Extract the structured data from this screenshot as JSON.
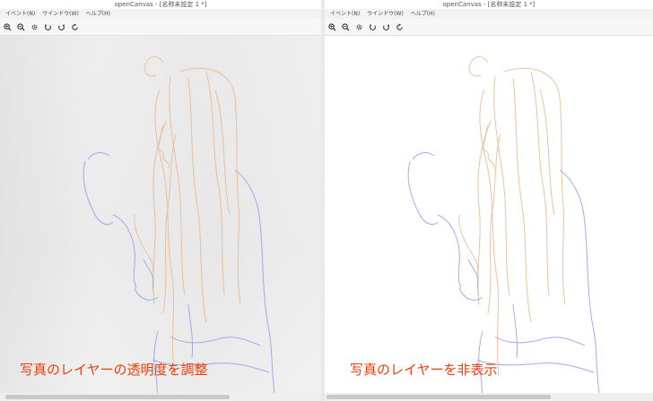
{
  "left_window": {
    "title": "openCanvas - [名称未設定 1 *]",
    "menu": [
      "イベント(N)",
      "ウインドウ(W)",
      "ヘルプ(H)"
    ],
    "tools": [
      "zoom-in-icon",
      "zoom-out-icon",
      "gear-icon",
      "rotate-left-icon",
      "rotate-right-icon",
      "refresh-icon"
    ],
    "caption": "写真のレイヤーの透明度を調整"
  },
  "right_window": {
    "title": "openCanvas - [名称未設定 1 *]",
    "menu": [
      "イベント(N)",
      "ウインドウ(W)",
      "ヘルプ(H)"
    ],
    "tools": [
      "zoom-in-icon",
      "zoom-out-icon",
      "gear-icon",
      "rotate-left-icon",
      "rotate-right-icon",
      "refresh-icon"
    ],
    "caption": "写真のレイヤーを非表示"
  },
  "colors": {
    "caption": "#e8400c",
    "sketch_orange": "#e8b890",
    "sketch_blue": "#9aa4e8"
  }
}
